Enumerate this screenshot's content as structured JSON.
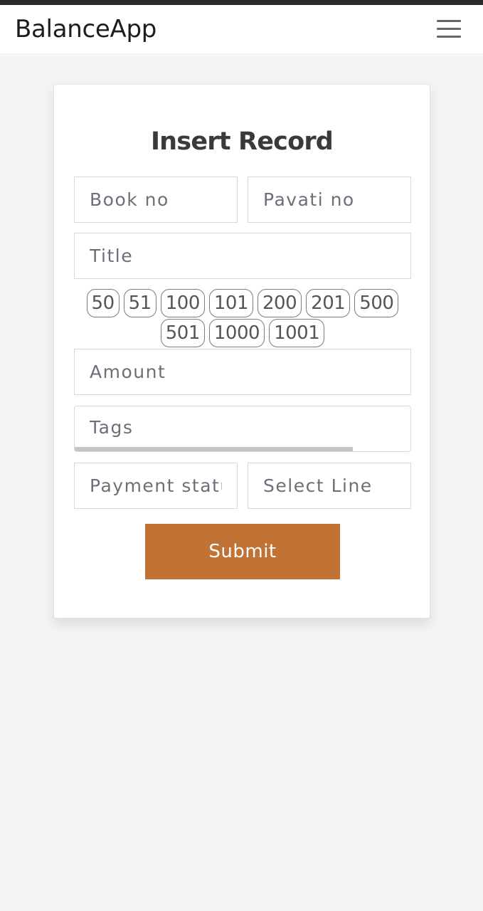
{
  "navbar": {
    "brand": "BalanceApp",
    "menu_icon": "hamburger-menu-icon"
  },
  "form": {
    "title": "Insert Record",
    "book_no_placeholder": "Book no",
    "pavati_no_placeholder": "Pavati no",
    "title_placeholder": "Title",
    "amount_chips_row1": [
      "50",
      "51",
      "100",
      "101",
      "200",
      "201",
      "500"
    ],
    "amount_chips_row2": [
      "501",
      "1000",
      "1001"
    ],
    "amount_placeholder": "Amount",
    "tags_placeholder": "Tags",
    "payment_status_placeholder": "Payment status",
    "select_line_placeholder": "Select Line",
    "submit_label": "Submit"
  },
  "colors": {
    "accent": "#c07335",
    "page_background": "#f4f4f4",
    "top_strip": "#2b2b2b"
  }
}
